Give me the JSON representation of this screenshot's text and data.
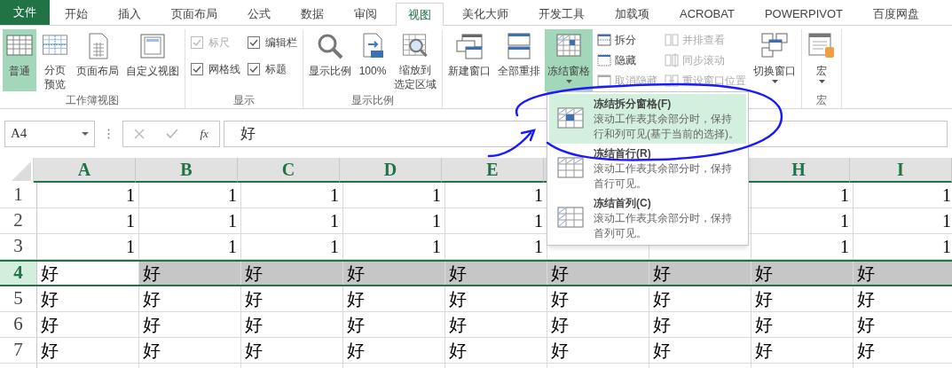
{
  "tabs": [
    {
      "label": "文件",
      "kind": "file",
      "selected": false
    },
    {
      "label": "开始",
      "selected": false
    },
    {
      "label": "插入",
      "selected": false
    },
    {
      "label": "页面布局",
      "selected": false
    },
    {
      "label": "公式",
      "selected": false
    },
    {
      "label": "数据",
      "selected": false
    },
    {
      "label": "审阅",
      "selected": false
    },
    {
      "label": "视图",
      "selected": true
    },
    {
      "label": "美化大师",
      "selected": false
    },
    {
      "label": "开发工具",
      "selected": false
    },
    {
      "label": "加载项",
      "selected": false
    },
    {
      "label": "ACROBAT",
      "selected": false
    },
    {
      "label": "POWERPIVOT",
      "selected": false
    },
    {
      "label": "百度网盘",
      "selected": false
    }
  ],
  "ribbon": {
    "groups": [
      {
        "label": "工作簿视图",
        "controls": [
          {
            "kind": "large",
            "label": "普通",
            "selected": true
          },
          {
            "kind": "large",
            "label": "分页预览",
            "selected": false
          },
          {
            "kind": "large",
            "label": "页面布局",
            "selected": false
          },
          {
            "kind": "large",
            "label": "自定义视图",
            "selected": false
          }
        ]
      },
      {
        "label": "显示",
        "controls": [
          {
            "kind": "stack",
            "items": [
              {
                "kind": "check",
                "label": "标尺",
                "checked": true,
                "disabled": true
              },
              {
                "kind": "check",
                "label": "网格线",
                "checked": true,
                "disabled": false
              }
            ]
          },
          {
            "kind": "stack",
            "items": [
              {
                "kind": "check",
                "label": "编辑栏",
                "checked": true,
                "disabled": false
              },
              {
                "kind": "check",
                "label": "标题",
                "checked": true,
                "disabled": false
              }
            ]
          }
        ]
      },
      {
        "label": "显示比例",
        "controls": [
          {
            "kind": "large",
            "label": "显示比例",
            "selected": false
          },
          {
            "kind": "large",
            "label": "100%",
            "selected": false
          },
          {
            "kind": "large",
            "label_lines": [
              "缩放到",
              "选定区域"
            ],
            "selected": false
          }
        ]
      },
      {
        "controls": [
          {
            "kind": "large",
            "label": "新建窗口",
            "selected": false
          },
          {
            "kind": "large",
            "label": "全部重排",
            "selected": false
          },
          {
            "kind": "large",
            "label": "冻结窗格",
            "selected": true,
            "dropdown": true
          },
          {
            "kind": "stack",
            "items": [
              {
                "kind": "small",
                "label": "拆分",
                "disabled": false
              },
              {
                "kind": "small",
                "label": "隐藏",
                "disabled": false
              },
              {
                "kind": "small",
                "label": "取消隐藏",
                "disabled": true
              }
            ]
          },
          {
            "kind": "stack",
            "items": [
              {
                "kind": "small",
                "label": "并排查看",
                "disabled": true
              },
              {
                "kind": "small",
                "label": "同步滚动",
                "disabled": true
              },
              {
                "kind": "small",
                "label": "重设窗口位置",
                "disabled": true
              }
            ]
          },
          {
            "kind": "large",
            "label": "切换窗口",
            "selected": false,
            "dropdown": true
          }
        ]
      },
      {
        "label": "宏",
        "controls": [
          {
            "kind": "large",
            "label": "宏",
            "selected": false,
            "dropdown": true
          }
        ]
      }
    ]
  },
  "formula_bar": {
    "name_box": "A4",
    "function_button": "fx",
    "formula": "好"
  },
  "sheet": {
    "columns": [
      {
        "label": "A"
      },
      {
        "label": "B"
      },
      {
        "label": "C"
      },
      {
        "label": "D"
      },
      {
        "label": "E"
      },
      {},
      {},
      {
        "label": "H"
      },
      {
        "label": "I"
      }
    ],
    "rows": [
      {
        "header": "1",
        "selected": false,
        "cells": [
          {
            "value": "1"
          },
          {
            "value": "1"
          },
          {
            "value": "1"
          },
          {
            "value": "1"
          },
          {
            "value": "1"
          },
          {},
          {},
          {
            "value": "1"
          },
          {
            "value": "1"
          }
        ]
      },
      {
        "header": "2",
        "selected": false,
        "cells": [
          {
            "value": "1"
          },
          {
            "value": "1"
          },
          {
            "value": "1"
          },
          {
            "value": "1"
          },
          {
            "value": "1"
          },
          {},
          {},
          {
            "value": "1"
          },
          {
            "value": "1"
          }
        ]
      },
      {
        "header": "3",
        "selected": false,
        "cells": [
          {
            "value": "1"
          },
          {
            "value": "1"
          },
          {
            "value": "1"
          },
          {
            "value": "1"
          },
          {
            "value": "1"
          },
          {},
          {},
          {
            "value": "1"
          },
          {
            "value": "1"
          }
        ]
      },
      {
        "header": "4",
        "selected": true,
        "cells": [
          {
            "value": "好",
            "active": true
          },
          {
            "value": "好"
          },
          {
            "value": "好"
          },
          {
            "value": "好"
          },
          {
            "value": "好"
          },
          {
            "value": "好"
          },
          {
            "value": "好"
          },
          {
            "value": "好"
          },
          {
            "value": "好"
          }
        ]
      },
      {
        "header": "5",
        "selected": false,
        "cells": [
          {
            "value": "好"
          },
          {
            "value": "好"
          },
          {
            "value": "好"
          },
          {
            "value": "好"
          },
          {
            "value": "好"
          },
          {
            "value": "好"
          },
          {
            "value": "好"
          },
          {
            "value": "好"
          },
          {
            "value": "好"
          }
        ]
      },
      {
        "header": "6",
        "selected": false,
        "cells": [
          {
            "value": "好"
          },
          {
            "value": "好"
          },
          {
            "value": "好"
          },
          {
            "value": "好"
          },
          {
            "value": "好"
          },
          {
            "value": "好"
          },
          {
            "value": "好"
          },
          {
            "value": "好"
          },
          {
            "value": "好"
          }
        ]
      },
      {
        "header": "7",
        "selected": false,
        "cells": [
          {
            "value": "好"
          },
          {
            "value": "好"
          },
          {
            "value": "好"
          },
          {
            "value": "好"
          },
          {
            "value": "好"
          },
          {
            "value": "好"
          },
          {
            "value": "好"
          },
          {
            "value": "好"
          },
          {
            "value": "好"
          }
        ]
      }
    ]
  },
  "freeze_menu": {
    "items": [
      {
        "title": "冻结拆分窗格(F)",
        "description": "滚动工作表其余部分时，保持行和列可见(基于当前的选择)。",
        "selected": true
      },
      {
        "title": "冻结首行(R)",
        "description": "滚动工作表其余部分时，保持首行可见。",
        "selected": false
      },
      {
        "title": "冻结首列(C)",
        "description": "滚动工作表其余部分时，保持首列可见。",
        "selected": false
      }
    ]
  }
}
